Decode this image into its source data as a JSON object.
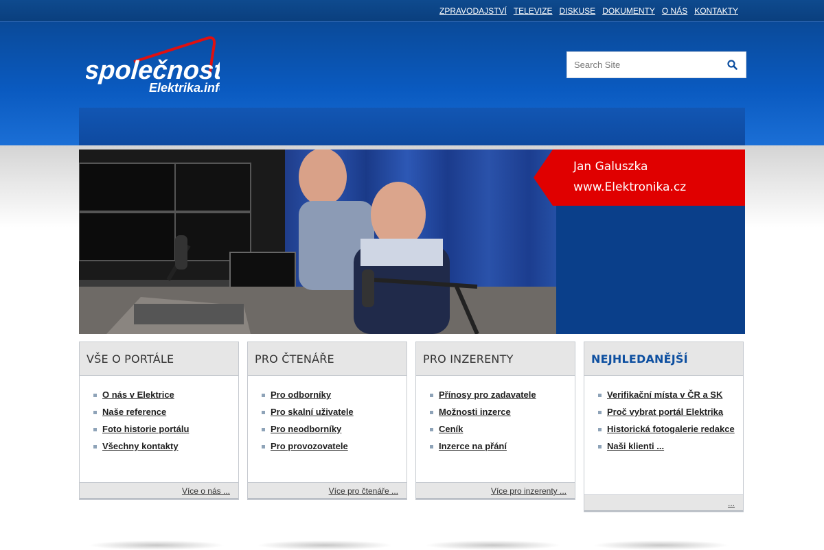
{
  "topnav": [
    "ZPRAVODAJSTVÍ",
    "TELEVIZE",
    "DISKUSE",
    "DOKUMENTY",
    "O NÁS",
    "KONTAKTY"
  ],
  "logo": {
    "line1": "společnost",
    "line2": "Elektrika.info"
  },
  "search": {
    "placeholder": "Search Site",
    "icon": "search-icon"
  },
  "hero": {
    "caption_line1": "Jan Galuszka",
    "caption_line2": "www.Elektronika.cz",
    "caption_color": "#e00000"
  },
  "boxes": [
    {
      "title": "VŠE O PORTÁLE",
      "links": [
        "O nás v Elektrice",
        "Naše reference",
        "Foto historie portálu",
        "Všechny kontakty"
      ],
      "more": "Více o nás ..."
    },
    {
      "title": "PRO ČTENÁŘE",
      "links": [
        "Pro odborníky",
        "Pro skalní uživatele",
        "Pro neodborníky",
        "Pro provozovatele"
      ],
      "more": "Více pro čtenáře ..."
    },
    {
      "title": "PRO INZERENTY",
      "links": [
        "Přínosy pro zadavatele",
        "Možnosti inzerce",
        "Ceník",
        "Inzerce na přání"
      ],
      "more": "Více pro inzerenty ..."
    },
    {
      "title": "NEJHLEDANĚJŠÍ",
      "links": [
        "Verifikační místa v ČR a SK",
        "Proč vybrat portál Elektrika",
        "Historická fotogalerie redakce",
        "Naši klienti ..."
      ],
      "more": "..."
    }
  ],
  "colors": {
    "brand_blue": "#0a4a99",
    "accent_red": "#e00000"
  }
}
